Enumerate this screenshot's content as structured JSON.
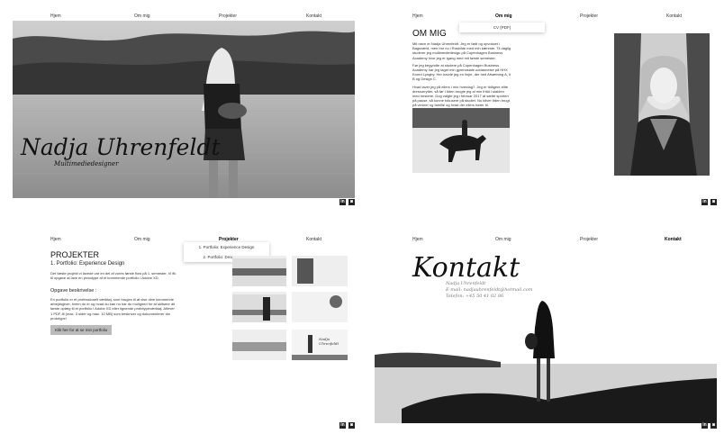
{
  "nav": {
    "home": "Hjem",
    "about": "Om mig",
    "projects": "Projekter",
    "contact": "Kontakt"
  },
  "hero": {
    "name": "Nadja Uhrenfeldt",
    "subtitle": "Multimediedesigner"
  },
  "about": {
    "dropdown_item": "CV (PDF)",
    "title": "OM MIG",
    "para1": "Mit navn er Nadja Uhrenfeldt. Jeg er født og opvokset i Bagsværd, men bor nu i Roskilde med min kæreste. Til daglig studerer jeg multimediedesign på Copenhagen Business Academy hvor jeg er igang med mit første semester.",
    "para2": "Før jeg begyndte at studere på Copenhagen Business Academy har jeg taget min gymnasiale uddannelse på HHX Knord Lyngby. Her havde jeg en linjre, der hed Afsætning A, it B og Design C.",
    "para3": "Hvad laver jeg på ellers i min hverdag?. Jeg er tidligere elite dressurrytter, så før i tiden brugte jeg al min fritid i stalden med hestene. Dog valgte jeg i februar 2017 at sætte sporten på pause, så kunne fokusere på studiet. Nu bliver tiden brugt på venner og familie og hvad der ellers hører til."
  },
  "projects": {
    "dropdown_items": [
      "1. Portfolio: Experience Design",
      "2. Portfolio: Dreamweaver"
    ],
    "title": "PROJEKTER",
    "subtitle": "1. Portfolio: Experience Design",
    "intro": "Det første projekt vi lavede var en del af vores første flow på 1. semester. Vi fik til opgave at lave en prototype af et kommende portfolio i Adobe XD.",
    "task_heading": "Opgave beskrivelse :",
    "task_text": "En portfolio er et professionelt værktøj, som bruges til at vise dine kommende arbejdsgiver, hvem du er og hvad du kan nu har du mulighed for at skitsere dit første oplæg til et portfolio i Adobe XD eller lignende prototypeværktøj. Aflevér 1 PDF-fil (max. 3 sider og max. 10 MB) som beskriver og dokumenterer din prototype!",
    "button": "Klik her for at se min portfolio",
    "thumb_caption": "Nadja Uhrenfeldt"
  },
  "contact": {
    "title": "Kontakt",
    "name": "Nadja Uhrenfeldt",
    "email": "E-mail: nadjauhrenfeldt@hotmail.com",
    "phone": "Telefon: +45 50 41 02 86"
  },
  "icons": {
    "linkedin": "in",
    "instagram": "◙"
  },
  "colors": {
    "text": "#222222",
    "button": "#bbbbbb",
    "dark": "#222222"
  }
}
